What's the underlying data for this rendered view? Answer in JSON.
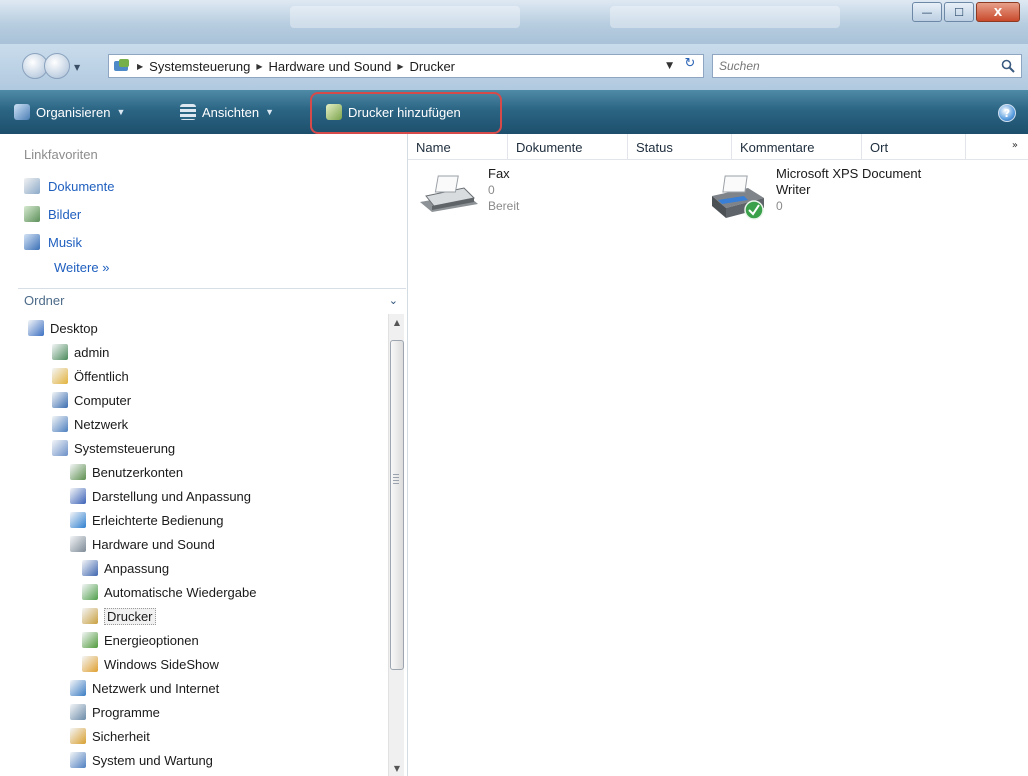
{
  "window": {
    "minimize_symbol": "—",
    "maximize_symbol": "☐",
    "close_symbol": "X"
  },
  "address": {
    "crumbs": [
      "Systemsteuerung",
      "Hardware und Sound",
      "Drucker"
    ],
    "separator_icon": "breadcrumb-arrow-icon",
    "refresh_symbol": "↻"
  },
  "search": {
    "placeholder": "Suchen"
  },
  "commandbar": {
    "organize_label": "Organisieren",
    "views_label": "Ansichten",
    "add_printer_label": "Drucker hinzufügen",
    "help_symbol": "?"
  },
  "favorites": {
    "title": "Linkfavoriten",
    "items": [
      {
        "label": "Dokumente",
        "icon": "documents-icon"
      },
      {
        "label": "Bilder",
        "icon": "pictures-icon"
      },
      {
        "label": "Musik",
        "icon": "music-icon"
      }
    ],
    "more_label": "Weitere",
    "more_symbol": "»"
  },
  "folders": {
    "title": "Ordner",
    "chevron": "⌄",
    "tree": [
      {
        "label": "Desktop",
        "level": 0,
        "icon": "desktop-icon",
        "color": "#3b6fc2"
      },
      {
        "label": "admin",
        "level": 1,
        "icon": "user-folder-icon",
        "color": "#4a8a5a"
      },
      {
        "label": "Öffentlich",
        "level": 1,
        "icon": "public-folder-icon",
        "color": "#e3b33c"
      },
      {
        "label": "Computer",
        "level": 1,
        "icon": "computer-icon",
        "color": "#3a6db0"
      },
      {
        "label": "Netzwerk",
        "level": 1,
        "icon": "network-icon",
        "color": "#4d7fbf"
      },
      {
        "label": "Systemsteuerung",
        "level": 1,
        "icon": "control-panel-icon",
        "color": "#6b8fc7"
      },
      {
        "label": "Benutzerkonten",
        "level": 2,
        "icon": "user-accounts-icon",
        "color": "#5d8f4e"
      },
      {
        "label": "Darstellung und Anpassung",
        "level": 2,
        "icon": "appearance-icon",
        "color": "#3c63b8"
      },
      {
        "label": "Erleichterte Bedienung",
        "level": 2,
        "icon": "accessibility-icon",
        "color": "#2f7fd0"
      },
      {
        "label": "Hardware und Sound",
        "level": 2,
        "icon": "hardware-sound-icon",
        "color": "#7d8a96"
      },
      {
        "label": "Anpassung",
        "level": 3,
        "icon": "personalization-icon",
        "color": "#3f66b0"
      },
      {
        "label": "Automatische Wiedergabe",
        "level": 3,
        "icon": "autoplay-icon",
        "color": "#4f9f4a"
      },
      {
        "label": "Drucker",
        "level": 3,
        "icon": "printer-icon",
        "color": "#c9a040",
        "selected": true
      },
      {
        "label": "Energieoptionen",
        "level": 3,
        "icon": "power-options-icon",
        "color": "#4f9a3a"
      },
      {
        "label": "Windows SideShow",
        "level": 3,
        "icon": "sideshow-icon",
        "color": "#e0a030"
      },
      {
        "label": "Netzwerk und Internet",
        "level": 2,
        "icon": "network-internet-icon",
        "color": "#3b7dc4"
      },
      {
        "label": "Programme",
        "level": 2,
        "icon": "programs-icon",
        "color": "#6a8aa8"
      },
      {
        "label": "Sicherheit",
        "level": 2,
        "icon": "security-shield-icon",
        "color": "#d9a030"
      },
      {
        "label": "System und Wartung",
        "level": 2,
        "icon": "system-maintenance-icon",
        "color": "#4e7fc0"
      }
    ]
  },
  "columns": [
    "Name",
    "Dokumente",
    "Status",
    "Kommentare",
    "Ort"
  ],
  "columns_more": "»",
  "printers": [
    {
      "name_lines": [
        "Fax"
      ],
      "docs": "0",
      "status": "Bereit",
      "icon": "fax-icon"
    },
    {
      "name_lines": [
        "Microsoft XPS Document",
        "Writer"
      ],
      "docs": "0",
      "status": "",
      "icon": "xps-printer-default-icon"
    }
  ],
  "colors": {
    "commandbar_top": "#4f8aa6",
    "commandbar_bottom": "#1d4f6c",
    "link_blue": "#1f5fbf",
    "annotation_red": "#d64a4a"
  }
}
